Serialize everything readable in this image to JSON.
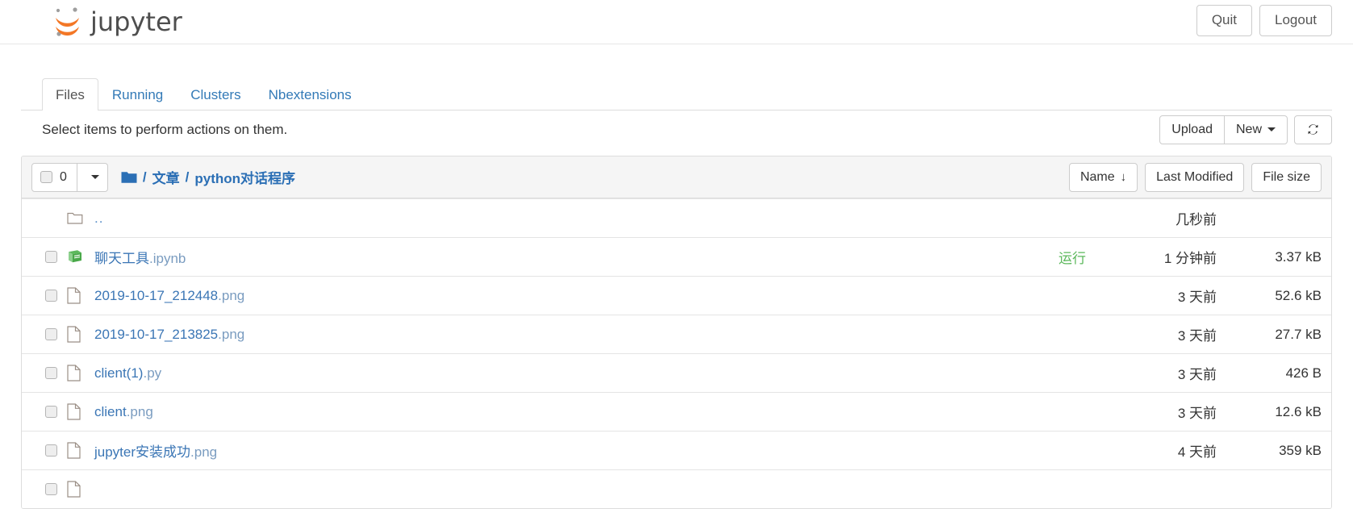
{
  "header": {
    "brand_text": "jupyter",
    "quit_label": "Quit",
    "logout_label": "Logout"
  },
  "tabs": [
    {
      "label": "Files",
      "active": true
    },
    {
      "label": "Running",
      "active": false
    },
    {
      "label": "Clusters",
      "active": false
    },
    {
      "label": "Nbextensions",
      "active": false
    }
  ],
  "toolbar": {
    "note": "Select items to perform actions on them.",
    "upload_label": "Upload",
    "new_label": "New",
    "refresh_icon": "refresh-icon"
  },
  "list_header": {
    "selected_count": "0",
    "folder_icon": "folder-icon",
    "breadcrumb": [
      "文章",
      "python对话程序"
    ],
    "separator": "/",
    "sort_name_label": "Name",
    "sort_name_arrow": "↓",
    "sort_modified_label": "Last Modified",
    "sort_size_label": "File size"
  },
  "rows": [
    {
      "icon": "folder-open-icon",
      "name": "..",
      "ext": "",
      "has_checkbox": false,
      "running": "",
      "modified": "几秒前",
      "size": ""
    },
    {
      "icon": "notebook-icon",
      "name": "聊天工具",
      "ext": ".ipynb",
      "has_checkbox": true,
      "running": "运行",
      "modified": "1 分钟前",
      "size": "3.37 kB"
    },
    {
      "icon": "file-icon",
      "name": "2019-10-17_212448",
      "ext": ".png",
      "has_checkbox": true,
      "running": "",
      "modified": "3 天前",
      "size": "52.6 kB"
    },
    {
      "icon": "file-icon",
      "name": "2019-10-17_213825",
      "ext": ".png",
      "has_checkbox": true,
      "running": "",
      "modified": "3 天前",
      "size": "27.7 kB"
    },
    {
      "icon": "file-icon",
      "name": "client(1)",
      "ext": ".py",
      "has_checkbox": true,
      "running": "",
      "modified": "3 天前",
      "size": "426 B"
    },
    {
      "icon": "file-icon",
      "name": "client",
      "ext": ".png",
      "has_checkbox": true,
      "running": "",
      "modified": "3 天前",
      "size": "12.6 kB"
    },
    {
      "icon": "file-icon",
      "name": "jupyter安装成功",
      "ext": ".png",
      "has_checkbox": true,
      "running": "",
      "modified": "4 天前",
      "size": "359 kB"
    },
    {
      "icon": "file-icon",
      "name": "",
      "ext": "",
      "has_checkbox": true,
      "running": "",
      "modified": "",
      "size": ""
    }
  ],
  "colors": {
    "brand_orange": "#f37726",
    "link_blue": "#337ab7",
    "crumb_blue": "#2b6fb5",
    "running_green": "#5cb85c",
    "border_gray": "#dddddd",
    "header_bg": "#f5f5f5"
  }
}
